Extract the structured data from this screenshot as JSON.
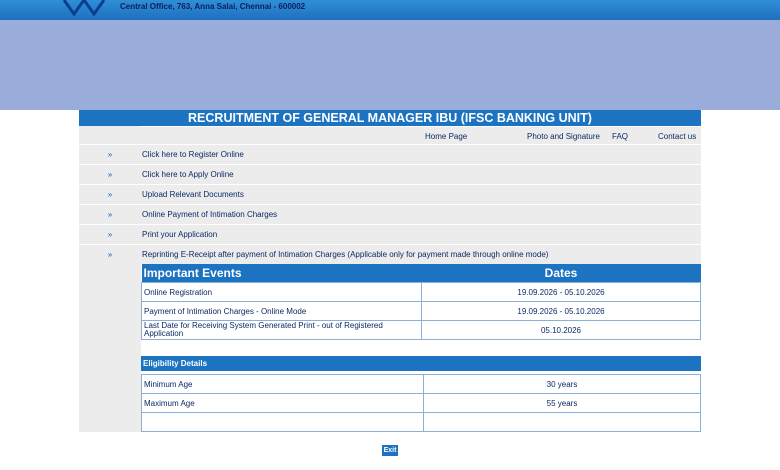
{
  "header": {
    "office_address": "Central Office, 763, Anna Salai, Chennai - 600002"
  },
  "page": {
    "title": "RECRUITMENT OF GENERAL MANAGER IBU (IFSC BANKING UNIT)"
  },
  "nav": {
    "home": "Home Page",
    "photo": "Photo and Signature",
    "faq": "FAQ",
    "contact": "Contact us"
  },
  "menu": {
    "arrow": "»",
    "items": [
      {
        "label": "Click here to Register Online"
      },
      {
        "label": "Click here to Apply Online"
      },
      {
        "label": "Upload Relevant Documents"
      },
      {
        "label": "Online Payment of Intimation Charges"
      },
      {
        "label": "Print your Application"
      },
      {
        "label": "Reprinting E-Receipt after payment of Intimation Charges (Applicable only for payment made through online mode)"
      }
    ]
  },
  "events": {
    "col1": "Important Events",
    "col2": "Dates",
    "rows": [
      {
        "event": "Online Registration",
        "date": "19.09.2026 - 05.10.2026"
      },
      {
        "event": "Payment of Intimation Charges - Online Mode",
        "date": "19.09.2026 - 05.10.2026"
      },
      {
        "event": "Last Date for Receiving System Generated Print - out of Registered Application",
        "date": "05.10.2026"
      }
    ]
  },
  "eligibility": {
    "title": "Eligibility Details",
    "rows": [
      {
        "label": "Minimum Age",
        "value": "30 years"
      },
      {
        "label": "Maximum Age",
        "value": "55 years"
      },
      {
        "label": "",
        "value": ""
      }
    ]
  },
  "footer": {
    "exit": "Exit"
  },
  "colors": {
    "accent": "#1b73c2",
    "banner": "#9aacd9",
    "menu_bg": "#ececec"
  }
}
